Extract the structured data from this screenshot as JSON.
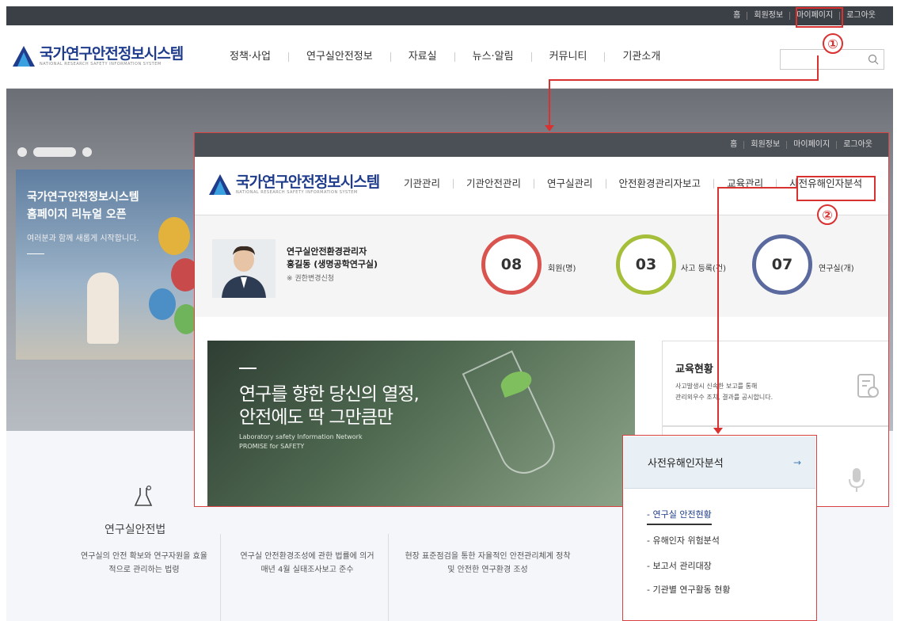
{
  "outer": {
    "topbar": [
      "홈",
      "회원정보",
      "마이페이지",
      "로그아웃"
    ],
    "logo": {
      "title": "국가연구안전정보시스템",
      "subtitle": "NATIONAL RESEARCH SAFETY INFORMATION SYSTEM"
    },
    "nav": [
      "정책·사업",
      "연구실안전정보",
      "자료실",
      "뉴스·알림",
      "커뮤니티",
      "기관소개"
    ],
    "hero": {
      "title_line1": "국가연구안전정보시스템",
      "title_line2": "홈페이지 리뉴얼 오픈",
      "desc": "여러분과 함께 새롭게 시작합니다."
    },
    "lower": {
      "icon_label": "연구실안전법",
      "col1": "연구실의 안전 확보와 연구자원을 효율적으로 관리하는 법령",
      "col2": "연구실 안전환경조성에 관한 법률에 의거 매년 4월 실태조사보고 준수",
      "col3": "현장 표준점검을 통한 자율적인 안전관리체계 정착 및 안전한 연구환경 조성"
    }
  },
  "panel": {
    "topbar": [
      "홈",
      "회원정보",
      "마이페이지",
      "로그아웃"
    ],
    "logo": {
      "title": "국가연구안전정보시스템",
      "subtitle": "NATIONAL RESEARCH SAFETY INFORMATION SYSTEM"
    },
    "nav": [
      "기관관리",
      "기관안전관리",
      "연구실관리",
      "안전환경관리자보고",
      "교육관리",
      "사전유해인자분석"
    ],
    "profile": {
      "role": "연구실안전환경관리자",
      "name": "홍길동 (생명공학연구실)",
      "note": "※ 권한변경신청"
    },
    "stats": [
      {
        "value": "08",
        "label": "회원(명)",
        "color": "#d9534f"
      },
      {
        "value": "03",
        "label": "사고 등록(건)",
        "color": "#a6bf3a"
      },
      {
        "value": "07",
        "label": "연구실(개)",
        "color": "#5b6a9e"
      }
    ],
    "banner": {
      "line1": "연구를 향한 당신의 열정,",
      "line2": "안전에도 딱 그만큼만",
      "en1": "Laboratory safety Information Network",
      "en2": "PROMISE for SAFETY"
    },
    "card": {
      "title": "교육현황",
      "line1": "사고발생시 신속한 보고를 통해",
      "line2": "관리외우수 조치, 결과를 공시합니다."
    }
  },
  "dropdown": {
    "title": "사전유해인자분석",
    "arrow": "→",
    "items": [
      "연구실 안전현황",
      "유해인자 위험분석",
      "보고서 관리대장",
      "기관별 연구활동 현황"
    ]
  },
  "markers": {
    "one": "①",
    "two": "②"
  },
  "colors": {
    "highlight": "#d93030",
    "brand": "#1f3d8c"
  }
}
